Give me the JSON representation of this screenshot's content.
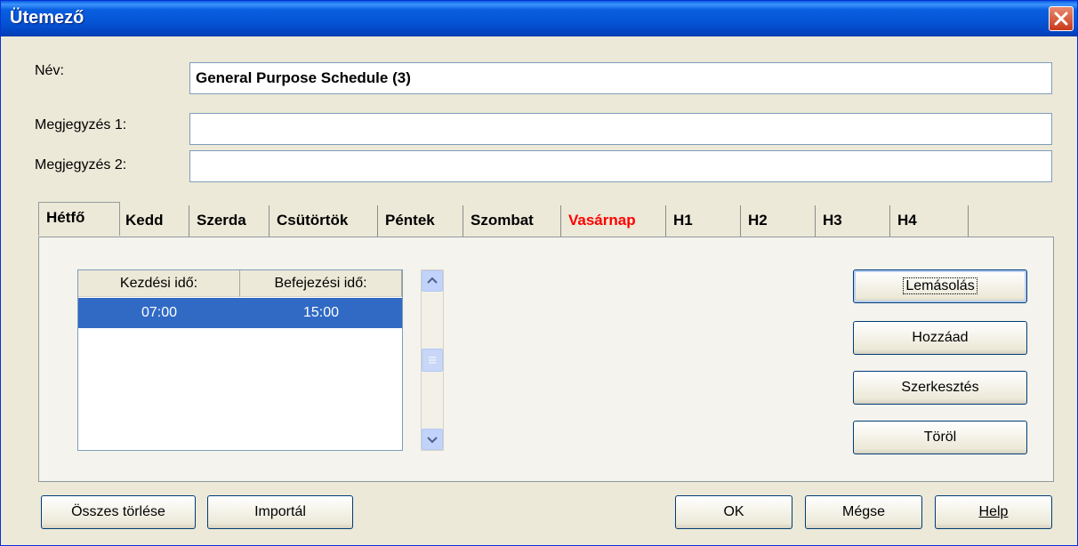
{
  "window": {
    "title": "Ütemező"
  },
  "form": {
    "name_label": "Név:",
    "name_value": "General Purpose Schedule (3)",
    "note1_label": "Megjegyzés 1:",
    "note1_value": "",
    "note2_label": "Megjegyzés 2:",
    "note2_value": ""
  },
  "tabs": [
    {
      "label": "Hétfő"
    },
    {
      "label": "Kedd"
    },
    {
      "label": "Szerda"
    },
    {
      "label": "Csütörtök"
    },
    {
      "label": "Péntek"
    },
    {
      "label": "Szombat"
    },
    {
      "label": "Vasárnap",
      "color": "#ff0000"
    },
    {
      "label": "H1"
    },
    {
      "label": "H2"
    },
    {
      "label": "H3"
    },
    {
      "label": "H4"
    }
  ],
  "schedule": {
    "columns": [
      "Kezdési idő:",
      "Befejezési idő:"
    ],
    "rows": [
      {
        "start": "07:00",
        "end": "15:00"
      }
    ]
  },
  "side_buttons": {
    "copy": "Lemásolás",
    "add": "Hozzáad",
    "edit": "Szerkesztés",
    "delete": "Töröl"
  },
  "bottom_buttons": {
    "clear_all": "Összes törlése",
    "import": "Importál",
    "ok": "OK",
    "cancel": "Mégse",
    "help": "Help"
  }
}
